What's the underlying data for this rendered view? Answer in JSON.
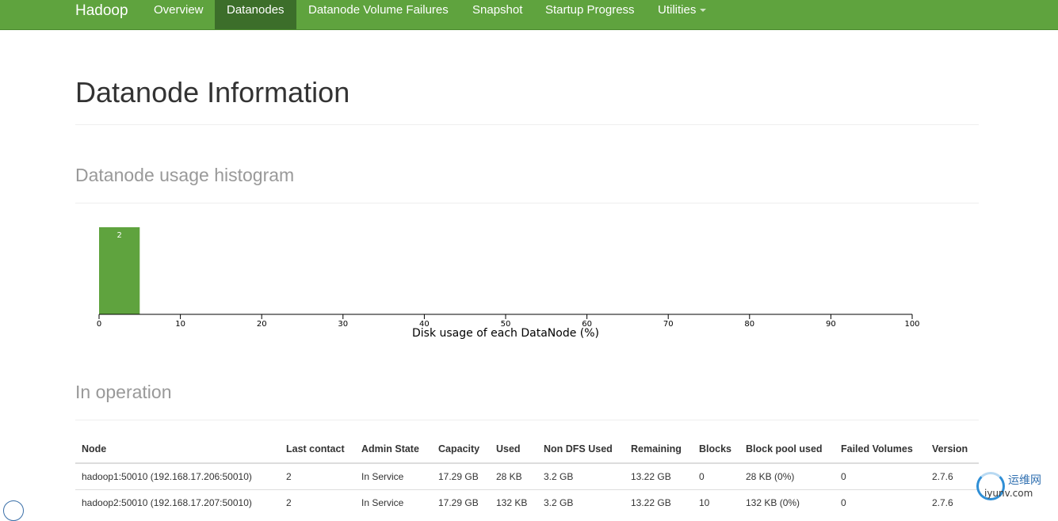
{
  "navbar": {
    "brand": "Hadoop",
    "items": [
      {
        "label": "Overview"
      },
      {
        "label": "Datanodes"
      },
      {
        "label": "Datanode Volume Failures"
      },
      {
        "label": "Snapshot"
      },
      {
        "label": "Startup Progress"
      },
      {
        "label": "Utilities"
      }
    ],
    "active": "Datanodes",
    "colors": {
      "background": "#5fa33e",
      "active": "#3c6e2a"
    }
  },
  "page_title": "Datanode Information",
  "histogram_section": {
    "title": "Datanode usage histogram"
  },
  "chart_data": {
    "type": "bar",
    "bins": [
      {
        "range": [
          0,
          5
        ],
        "count": 2
      }
    ],
    "bar_labels": [
      "2"
    ],
    "x_ticks": [
      "0",
      "10",
      "20",
      "30",
      "40",
      "50",
      "60",
      "70",
      "80",
      "90",
      "100"
    ],
    "xlim": [
      0,
      100
    ],
    "xlabel": "Disk usage of each DataNode (%)",
    "bar_color": "#5fa33e"
  },
  "operation_section": {
    "title": "In operation"
  },
  "table": {
    "columns": [
      "Node",
      "Last contact",
      "Admin State",
      "Capacity",
      "Used",
      "Non DFS Used",
      "Remaining",
      "Blocks",
      "Block pool used",
      "Failed Volumes",
      "Version"
    ],
    "rows": [
      [
        "hadoop1:50010 (192.168.17.206:50010)",
        "2",
        "In Service",
        "17.29 GB",
        "28 KB",
        "3.2 GB",
        "13.22 GB",
        "0",
        "28 KB (0%)",
        "0",
        "2.7.6"
      ],
      [
        "hadoop2:50010 (192.168.17.207:50010)",
        "2",
        "In Service",
        "17.29 GB",
        "132 KB",
        "3.2 GB",
        "13.22 GB",
        "10",
        "132 KB (0%)",
        "0",
        "2.7.6"
      ]
    ]
  },
  "watermark": {
    "cn": "运维网",
    "url": "iyunv.com"
  }
}
